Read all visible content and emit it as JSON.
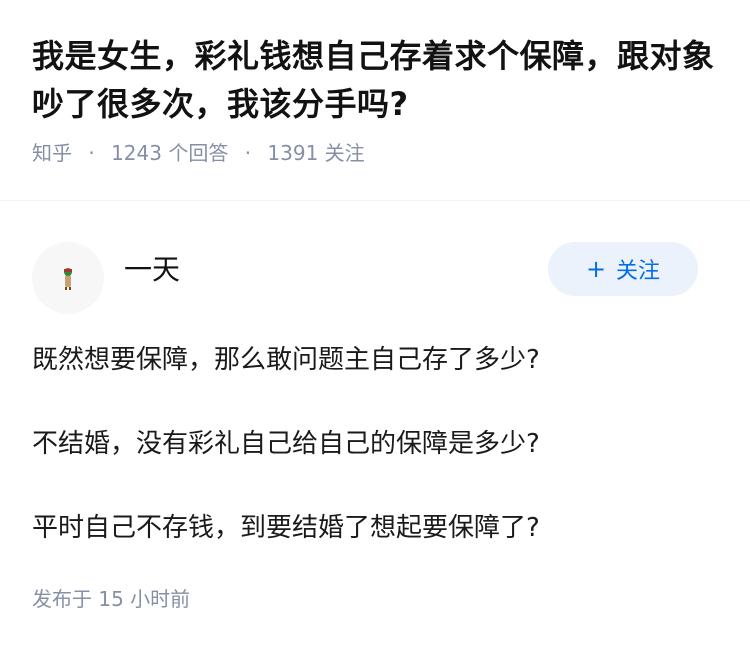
{
  "question": {
    "title": "我是女生，彩礼钱想自己存着求个保障，跟对象吵了很多次，我该分手吗?",
    "source": "知乎",
    "separator": "·",
    "answers": "1243 个回答",
    "followers": "1391 关注"
  },
  "answer": {
    "author": "一天",
    "follow_button": "关注",
    "paragraphs": [
      "既然想要保障，那么敢问题主自己存了多少?",
      "不结婚，没有彩礼自己给自己的保障是多少?",
      "平时自己不存钱，到要结婚了想起要保障了?"
    ],
    "published": "发布于  15 小时前"
  },
  "colors": {
    "accent": "#056de8",
    "follow_bg": "#ebf2fc",
    "meta_text": "#8590a6"
  },
  "icons": {
    "avatar": "small-figure-avatar-icon",
    "follow": "plus-icon"
  }
}
